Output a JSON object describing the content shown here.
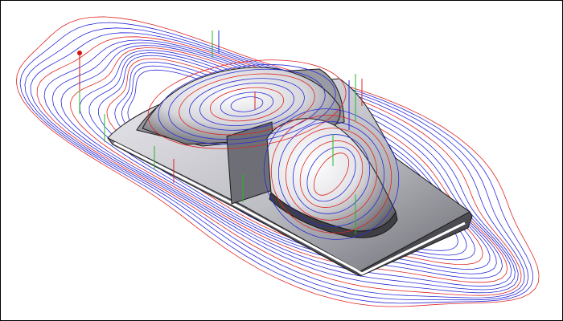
{
  "viewport": {
    "content": "cam-toolpath-3d-view",
    "background": "#ffffff",
    "border_color": "#000000"
  },
  "colors": {
    "toolpath_feed": "#2a2ad8",
    "toolpath_rapid": "#e02424",
    "toolpath_lead": "#26b826",
    "part_surface_light": "#f4f4f6",
    "part_surface_dark": "#4e4e56",
    "part_edge": "#1a1a1a",
    "origin_marker": "#d41111"
  },
  "icons": {
    "origin_marker": "origin-dot-icon"
  }
}
